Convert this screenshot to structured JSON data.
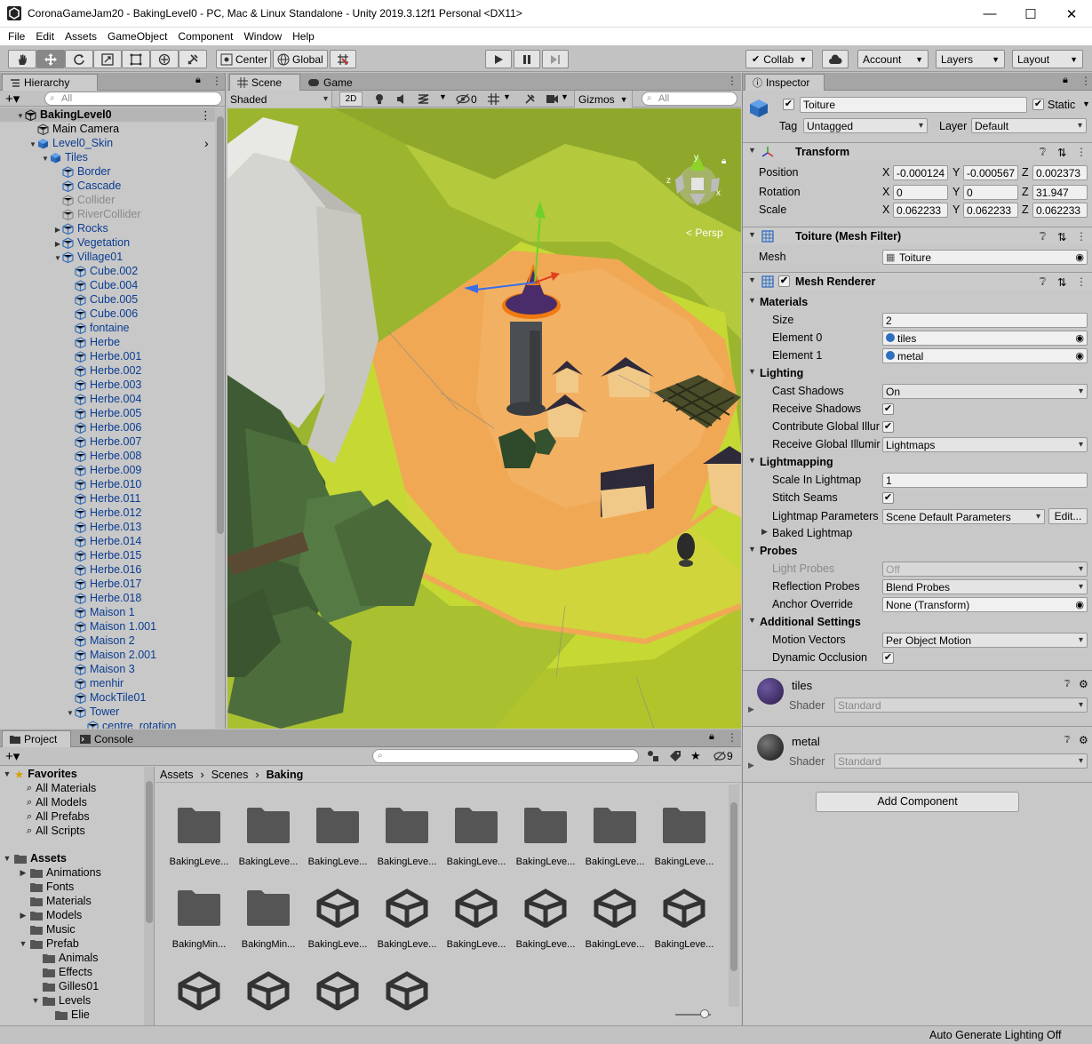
{
  "window": {
    "title": "CoronaGameJam20 - BakingLevel0 - PC, Mac & Linux Standalone - Unity 2019.3.12f1 Personal <DX11>",
    "minimize": "—",
    "maximize": "☐",
    "close": "✕"
  },
  "menu": [
    "File",
    "Edit",
    "Assets",
    "GameObject",
    "Component",
    "Window",
    "Help"
  ],
  "toolbar": {
    "pivot": "Center",
    "space": "Global",
    "collab": "Collab",
    "account": "Account",
    "layers": "Layers",
    "layout": "Layout"
  },
  "hierarchy": {
    "tab": "Hierarchy",
    "search_placeholder": "All",
    "items": [
      {
        "label": "BakingLevel0",
        "depth": 0,
        "arrow": "down",
        "icon": "scene",
        "style": "bold"
      },
      {
        "label": "Main Camera",
        "depth": 1,
        "arrow": "",
        "icon": "cube",
        "style": "black"
      },
      {
        "label": "Level0_Skin",
        "depth": 1,
        "arrow": "down",
        "icon": "prefab",
        "style": "blue"
      },
      {
        "label": "Tiles",
        "depth": 2,
        "arrow": "down",
        "icon": "prefab",
        "style": "blue"
      },
      {
        "label": "Border",
        "depth": 3,
        "arrow": "",
        "icon": "cube",
        "style": "blue"
      },
      {
        "label": "Cascade",
        "depth": 3,
        "arrow": "",
        "icon": "cube",
        "style": "blue"
      },
      {
        "label": "Collider",
        "depth": 3,
        "arrow": "",
        "icon": "cube",
        "style": "grey"
      },
      {
        "label": "RiverCollider",
        "depth": 3,
        "arrow": "",
        "icon": "cube",
        "style": "grey"
      },
      {
        "label": "Rocks",
        "depth": 3,
        "arrow": "right",
        "icon": "cube",
        "style": "blue"
      },
      {
        "label": "Vegetation",
        "depth": 3,
        "arrow": "right",
        "icon": "cube",
        "style": "blue"
      },
      {
        "label": "Village01",
        "depth": 3,
        "arrow": "down",
        "icon": "cube",
        "style": "blue"
      },
      {
        "label": "Cube.002",
        "depth": 4,
        "arrow": "",
        "icon": "cube",
        "style": "blue"
      },
      {
        "label": "Cube.004",
        "depth": 4,
        "arrow": "",
        "icon": "cube",
        "style": "blue"
      },
      {
        "label": "Cube.005",
        "depth": 4,
        "arrow": "",
        "icon": "cube",
        "style": "blue"
      },
      {
        "label": "Cube.006",
        "depth": 4,
        "arrow": "",
        "icon": "cube",
        "style": "blue"
      },
      {
        "label": "fontaine",
        "depth": 4,
        "arrow": "",
        "icon": "cube",
        "style": "blue"
      },
      {
        "label": "Herbe",
        "depth": 4,
        "arrow": "",
        "icon": "cube",
        "style": "blue"
      },
      {
        "label": "Herbe.001",
        "depth": 4,
        "arrow": "",
        "icon": "cube",
        "style": "blue"
      },
      {
        "label": "Herbe.002",
        "depth": 4,
        "arrow": "",
        "icon": "cube",
        "style": "blue"
      },
      {
        "label": "Herbe.003",
        "depth": 4,
        "arrow": "",
        "icon": "cube",
        "style": "blue"
      },
      {
        "label": "Herbe.004",
        "depth": 4,
        "arrow": "",
        "icon": "cube",
        "style": "blue"
      },
      {
        "label": "Herbe.005",
        "depth": 4,
        "arrow": "",
        "icon": "cube",
        "style": "blue"
      },
      {
        "label": "Herbe.006",
        "depth": 4,
        "arrow": "",
        "icon": "cube",
        "style": "blue"
      },
      {
        "label": "Herbe.007",
        "depth": 4,
        "arrow": "",
        "icon": "cube",
        "style": "blue"
      },
      {
        "label": "Herbe.008",
        "depth": 4,
        "arrow": "",
        "icon": "cube",
        "style": "blue"
      },
      {
        "label": "Herbe.009",
        "depth": 4,
        "arrow": "",
        "icon": "cube",
        "style": "blue"
      },
      {
        "label": "Herbe.010",
        "depth": 4,
        "arrow": "",
        "icon": "cube",
        "style": "blue"
      },
      {
        "label": "Herbe.011",
        "depth": 4,
        "arrow": "",
        "icon": "cube",
        "style": "blue"
      },
      {
        "label": "Herbe.012",
        "depth": 4,
        "arrow": "",
        "icon": "cube",
        "style": "blue"
      },
      {
        "label": "Herbe.013",
        "depth": 4,
        "arrow": "",
        "icon": "cube",
        "style": "blue"
      },
      {
        "label": "Herbe.014",
        "depth": 4,
        "arrow": "",
        "icon": "cube",
        "style": "blue"
      },
      {
        "label": "Herbe.015",
        "depth": 4,
        "arrow": "",
        "icon": "cube",
        "style": "blue"
      },
      {
        "label": "Herbe.016",
        "depth": 4,
        "arrow": "",
        "icon": "cube",
        "style": "blue"
      },
      {
        "label": "Herbe.017",
        "depth": 4,
        "arrow": "",
        "icon": "cube",
        "style": "blue"
      },
      {
        "label": "Herbe.018",
        "depth": 4,
        "arrow": "",
        "icon": "cube",
        "style": "blue"
      },
      {
        "label": "Maison 1",
        "depth": 4,
        "arrow": "",
        "icon": "cube",
        "style": "blue"
      },
      {
        "label": "Maison 1.001",
        "depth": 4,
        "arrow": "",
        "icon": "cube",
        "style": "blue"
      },
      {
        "label": "Maison 2",
        "depth": 4,
        "arrow": "",
        "icon": "cube",
        "style": "blue"
      },
      {
        "label": "Maison 2.001",
        "depth": 4,
        "arrow": "",
        "icon": "cube",
        "style": "blue"
      },
      {
        "label": "Maison 3",
        "depth": 4,
        "arrow": "",
        "icon": "cube",
        "style": "blue"
      },
      {
        "label": "menhir",
        "depth": 4,
        "arrow": "",
        "icon": "cube",
        "style": "blue"
      },
      {
        "label": "MockTile01",
        "depth": 4,
        "arrow": "",
        "icon": "cube",
        "style": "blue"
      },
      {
        "label": "Tower",
        "depth": 4,
        "arrow": "down",
        "icon": "cube",
        "style": "blue"
      },
      {
        "label": "centre_rotation",
        "depth": 5,
        "arrow": "",
        "icon": "cube",
        "style": "blue"
      }
    ]
  },
  "scene": {
    "tab_scene": "Scene",
    "tab_game": "Game",
    "shading": "Shaded",
    "mode_2d": "2D",
    "hidden_count": "0",
    "gizmos": "Gizmos",
    "search_placeholder": "All",
    "persp": "Persp",
    "axis_x": "x",
    "axis_y": "y",
    "axis_z": "z"
  },
  "inspector": {
    "tab": "Inspector",
    "object_name": "Toiture",
    "static_label": "Static",
    "tag_label": "Tag",
    "tag_value": "Untagged",
    "layer_label": "Layer",
    "layer_value": "Default",
    "transform": {
      "title": "Transform",
      "position_label": "Position",
      "rotation_label": "Rotation",
      "scale_label": "Scale",
      "position": [
        "-0.000124",
        "-0.000567",
        "0.002373"
      ],
      "rotation": [
        "0",
        "0",
        "31.947"
      ],
      "scale": [
        "0.062233",
        "0.062233",
        "0.062233"
      ],
      "x": "X",
      "y": "Y",
      "z": "Z"
    },
    "mesh_filter": {
      "title": "Toiture (Mesh Filter)",
      "mesh_label": "Mesh",
      "mesh_value": "Toiture"
    },
    "mesh_renderer": {
      "title": "Mesh Renderer",
      "materials": "Materials",
      "size_label": "Size",
      "size_value": "2",
      "element0_label": "Element 0",
      "element0_value": "tiles",
      "element1_label": "Element 1",
      "element1_value": "metal",
      "lighting": "Lighting",
      "cast_shadows_label": "Cast Shadows",
      "cast_shadows_value": "On",
      "receive_shadows_label": "Receive Shadows",
      "contribute_gi_label": "Contribute Global Illur",
      "receive_gi_label": "Receive Global Illumir",
      "receive_gi_value": "Lightmaps",
      "lightmapping": "Lightmapping",
      "scale_lightmap_label": "Scale In Lightmap",
      "scale_lightmap_value": "1",
      "stitch_seams_label": "Stitch Seams",
      "lightmap_params_label": "Lightmap Parameters",
      "lightmap_params_value": "Scene Default Parameters",
      "edit_button": "Edit...",
      "baked_lightmap": "Baked Lightmap",
      "probes": "Probes",
      "light_probes_label": "Light Probes",
      "light_probes_value": "Off",
      "reflection_probes_label": "Reflection Probes",
      "reflection_probes_value": "Blend Probes",
      "anchor_override_label": "Anchor Override",
      "anchor_override_value": "None (Transform)",
      "additional_settings": "Additional Settings",
      "motion_vectors_label": "Motion Vectors",
      "motion_vectors_value": "Per Object Motion",
      "dynamic_occlusion_label": "Dynamic Occlusion"
    },
    "materials": [
      {
        "name": "tiles",
        "shader_label": "Shader",
        "shader": "Standard",
        "color": "#3b2a5e"
      },
      {
        "name": "metal",
        "shader_label": "Shader",
        "shader": "Standard",
        "color": "#333333"
      }
    ],
    "add_component": "Add Component"
  },
  "project": {
    "tab_project": "Project",
    "tab_console": "Console",
    "hidden_count": "9",
    "favorites": "Favorites",
    "favorite_items": [
      "All Materials",
      "All Models",
      "All Prefabs",
      "All Scripts"
    ],
    "assets_root": "Assets",
    "tree": [
      {
        "label": "Animations",
        "depth": 1,
        "arrow": "right"
      },
      {
        "label": "Fonts",
        "depth": 1,
        "arrow": ""
      },
      {
        "label": "Materials",
        "depth": 1,
        "arrow": ""
      },
      {
        "label": "Models",
        "depth": 1,
        "arrow": "right"
      },
      {
        "label": "Music",
        "depth": 1,
        "arrow": ""
      },
      {
        "label": "Prefab",
        "depth": 1,
        "arrow": "down"
      },
      {
        "label": "Animals",
        "depth": 2,
        "arrow": ""
      },
      {
        "label": "Effects",
        "depth": 2,
        "arrow": ""
      },
      {
        "label": "Gilles01",
        "depth": 2,
        "arrow": ""
      },
      {
        "label": "Levels",
        "depth": 2,
        "arrow": "down"
      },
      {
        "label": "Elie",
        "depth": 3,
        "arrow": ""
      }
    ],
    "breadcrumb": [
      "Assets",
      "Scenes",
      "Baking"
    ],
    "grid": [
      {
        "label": "BakingLeve...",
        "kind": "folder"
      },
      {
        "label": "BakingLeve...",
        "kind": "folder"
      },
      {
        "label": "BakingLeve...",
        "kind": "folder"
      },
      {
        "label": "BakingLeve...",
        "kind": "folder"
      },
      {
        "label": "BakingLeve...",
        "kind": "folder"
      },
      {
        "label": "BakingLeve...",
        "kind": "folder"
      },
      {
        "label": "BakingLeve...",
        "kind": "folder"
      },
      {
        "label": "BakingLeve...",
        "kind": "folder"
      },
      {
        "label": "BakingMin...",
        "kind": "folder"
      },
      {
        "label": "BakingMin...",
        "kind": "folder"
      },
      {
        "label": "BakingLeve...",
        "kind": "unity"
      },
      {
        "label": "BakingLeve...",
        "kind": "unity"
      },
      {
        "label": "BakingLeve...",
        "kind": "unity"
      },
      {
        "label": "BakingLeve...",
        "kind": "unity"
      },
      {
        "label": "BakingLeve...",
        "kind": "unity"
      },
      {
        "label": "BakingLeve...",
        "kind": "unity"
      },
      {
        "label": "",
        "kind": "unity"
      },
      {
        "label": "",
        "kind": "unity"
      },
      {
        "label": "",
        "kind": "unity"
      },
      {
        "label": "",
        "kind": "unity"
      }
    ]
  },
  "status": {
    "text": "Auto Generate Lighting Off"
  }
}
